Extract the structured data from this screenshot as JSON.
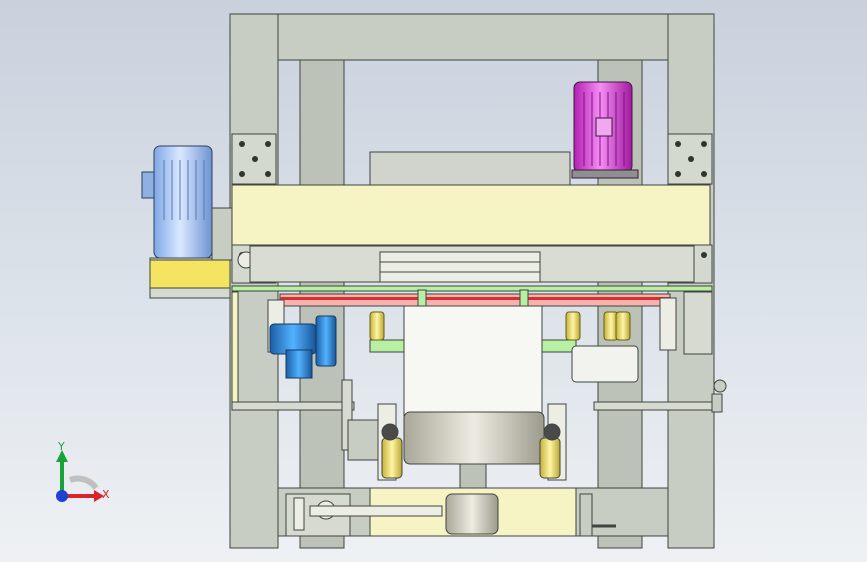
{
  "colors": {
    "frame": "#c7cdc2",
    "frame_edge": "#3f4540",
    "beam_yellow": "#f6f4c4",
    "motor_blue": "#a9c6f0",
    "motor_magenta": "#e043e0",
    "pump_blue": "#2f8fe0",
    "green_rail": "#b7f0a2",
    "roller_yellow": "#f4e462",
    "drum": "#d6d3c6",
    "axis_x": "#d8242a",
    "axis_y": "#1aa23a",
    "axis_z": "#1f3fd6"
  },
  "triad": {
    "y_label": "Y",
    "x_label": "X"
  }
}
